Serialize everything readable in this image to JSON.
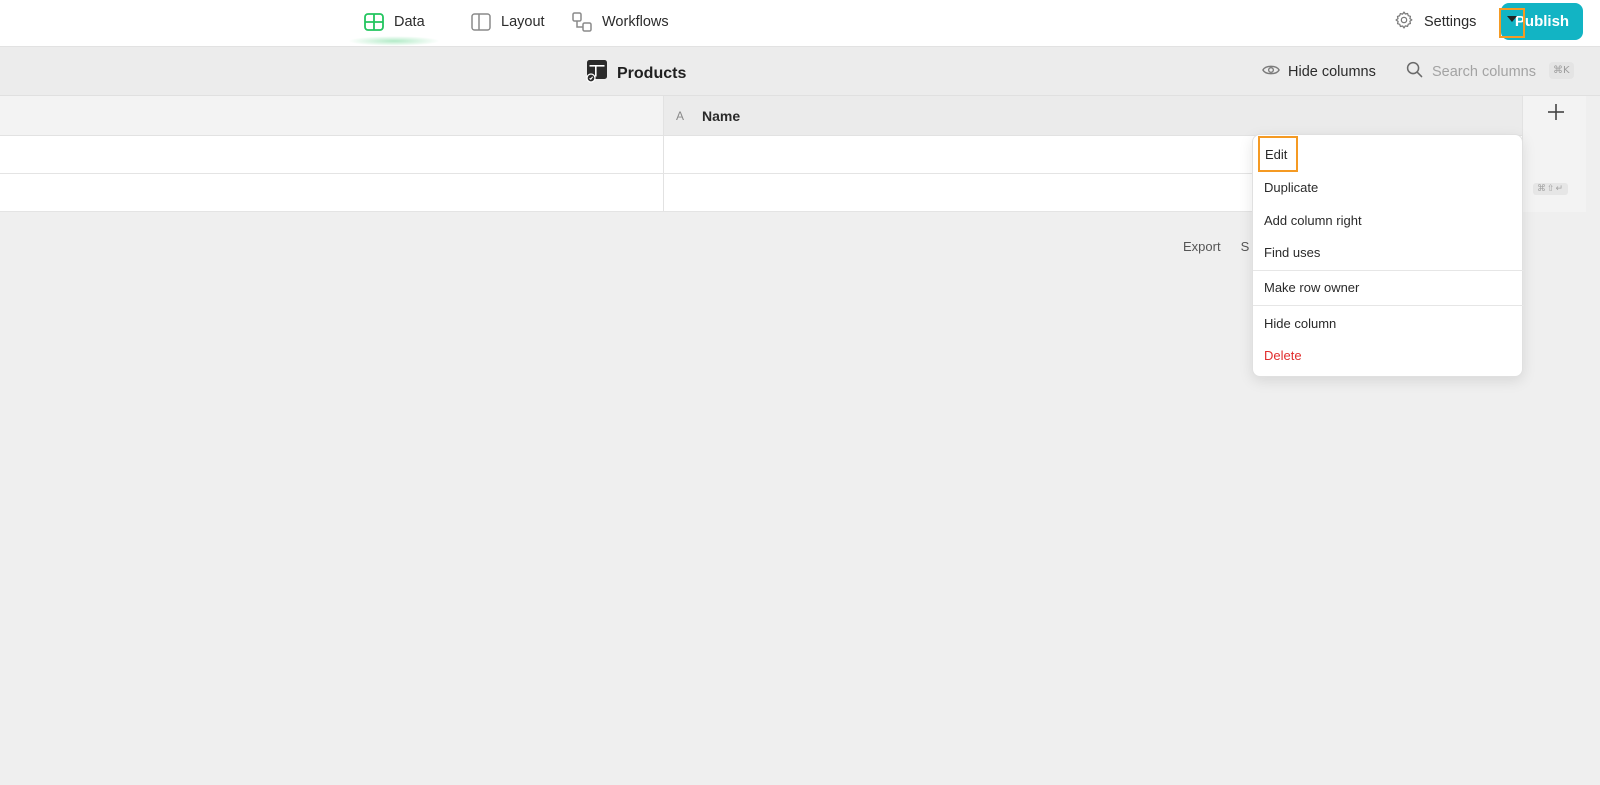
{
  "nav": {
    "tabs": [
      {
        "label": "Data",
        "icon": "table-icon",
        "active": true
      },
      {
        "label": "Layout",
        "icon": "layout-icon"
      },
      {
        "label": "Workflows",
        "icon": "workflows-icon"
      }
    ],
    "settings_label": "Settings",
    "publish_label": "Publish"
  },
  "table": {
    "title": "Products",
    "hide_columns_label": "Hide columns",
    "search_placeholder": "Search columns",
    "search_shortcut": "⌘K",
    "columns": [
      {
        "label": "",
        "type_icon": ""
      },
      {
        "label": "Name",
        "type_icon": "A"
      }
    ],
    "add_column_shortcut": "⌘⇧↵",
    "footer_links": [
      "Export",
      "S"
    ]
  },
  "column_menu": {
    "items": [
      {
        "label": "Edit"
      },
      {
        "label": "Duplicate"
      },
      {
        "label": "Add column right"
      },
      {
        "label": "Find uses"
      },
      {
        "label": "Make row owner"
      },
      {
        "label": "Hide column"
      },
      {
        "label": "Delete"
      }
    ]
  },
  "colors": {
    "accent": "#12b4c4",
    "active_tab": "#22c55e",
    "highlight": "#f59a23",
    "danger": "#e12d2d"
  }
}
